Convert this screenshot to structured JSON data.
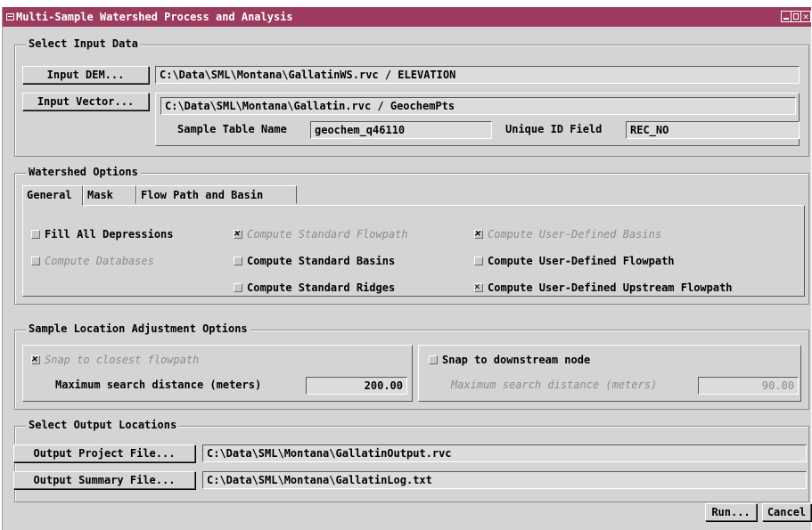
{
  "window": {
    "title": "Multi-Sample Watershed Process and Analysis",
    "close_glyph": "✕"
  },
  "input": {
    "legend": "Select Input Data",
    "dem_button": "Input DEM...",
    "dem_path": "C:\\Data\\SML\\Montana\\GallatinWS.rvc / ELEVATION",
    "vector_button": "Input Vector...",
    "vector_path": "C:\\Data\\SML\\Montana\\Gallatin.rvc / GeochemPts",
    "sample_table_label": "Sample Table Name",
    "sample_table_value": "geochem_q46110",
    "unique_id_label": "Unique ID Field",
    "unique_id_value": "REC_NO"
  },
  "watershed": {
    "legend": "Watershed Options",
    "tabs": [
      "General",
      "Mask",
      "Flow Path and Basin"
    ],
    "options": {
      "fill_depressions": {
        "label": "Fill All Depressions",
        "checked": false,
        "enabled": true
      },
      "compute_std_flowpath": {
        "label": "Compute Standard Flowpath",
        "checked": true,
        "enabled": false
      },
      "compute_user_basins": {
        "label": "Compute User-Defined Basins",
        "checked": true,
        "enabled": false
      },
      "compute_databases": {
        "label": "Compute Databases",
        "checked": false,
        "enabled": false
      },
      "compute_std_basins": {
        "label": "Compute Standard Basins",
        "checked": false,
        "enabled": true
      },
      "compute_user_flowpath": {
        "label": "Compute User-Defined Flowpath",
        "checked": false,
        "enabled": true
      },
      "compute_std_ridges": {
        "label": "Compute Standard Ridges",
        "checked": false,
        "enabled": true
      },
      "compute_user_upstream": {
        "label": "Compute User-Defined Upstream Flowpath",
        "checked": true,
        "enabled": true
      }
    }
  },
  "sample": {
    "legend": "Sample Location Adjustment Options",
    "snap_closest_label": "Snap to closest flowpath",
    "snap_closest_checked": true,
    "max_dist_label_left": "Maximum search distance (meters)",
    "max_dist_value_left": "200.00",
    "snap_downstream_label": "Snap to downstream node",
    "snap_downstream_checked": false,
    "max_dist_label_right": "Maximum search distance (meters)",
    "max_dist_value_right": "90.00"
  },
  "output": {
    "legend": "Select Output Locations",
    "project_button": "Output Project File...",
    "project_path": "C:\\Data\\SML\\Montana\\GallatinOutput.rvc",
    "summary_button": "Output Summary File...",
    "summary_path": "C:\\Data\\SML\\Montana\\GallatinLog.txt"
  },
  "actions": {
    "run": "Run...",
    "cancel": "Cancel"
  }
}
